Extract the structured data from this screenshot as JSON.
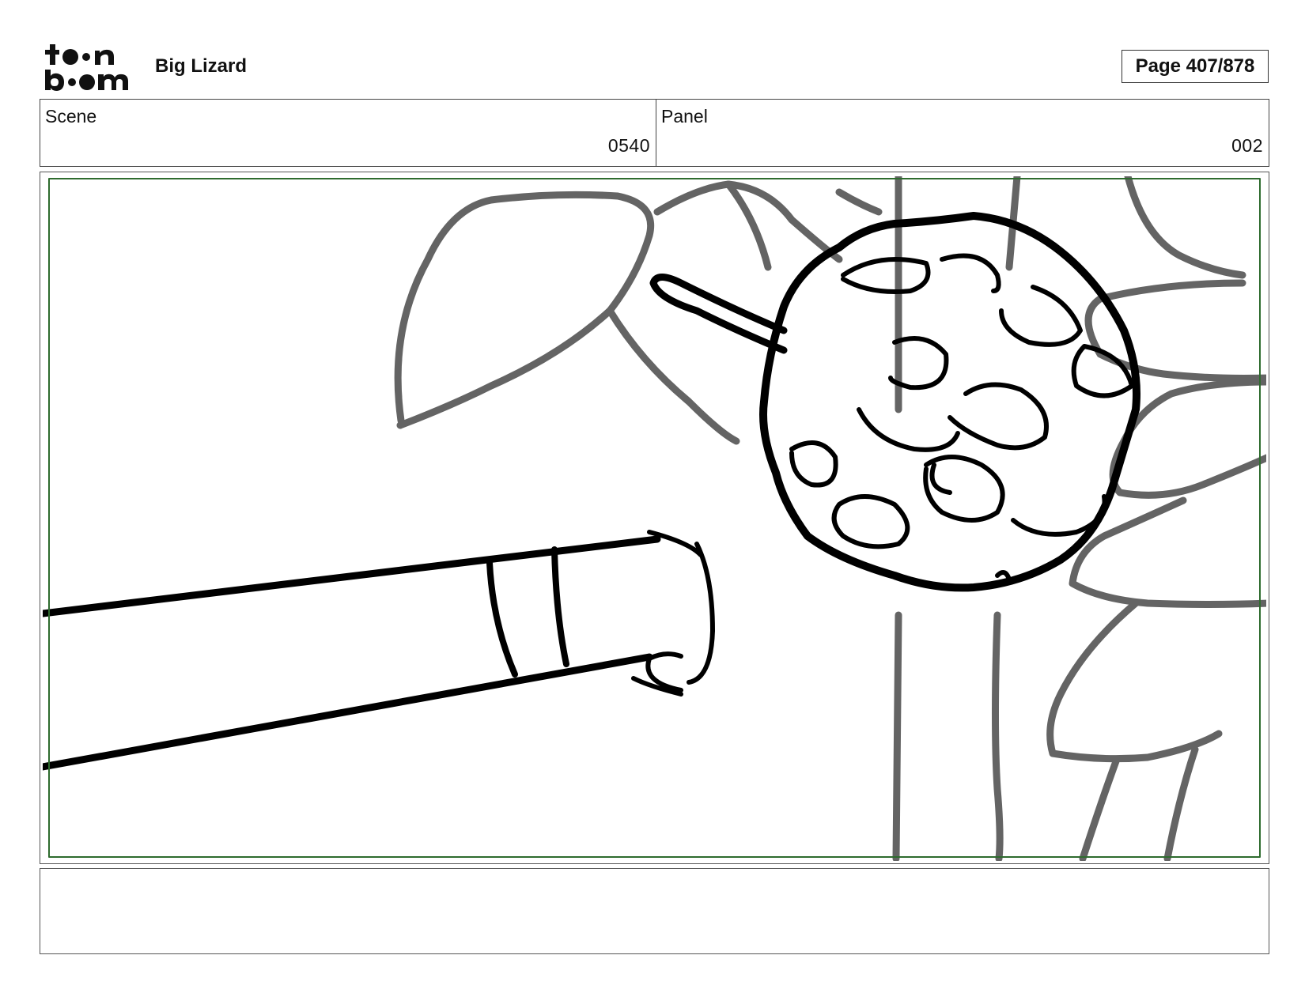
{
  "header": {
    "logo_text_top": "toon",
    "logo_text_bottom": "boom",
    "project_title": "Big Lizard",
    "page_indicator": "Page 407/878"
  },
  "info": {
    "scene_label": "Scene",
    "scene_value": "0540",
    "panel_label": "Panel",
    "panel_value": "002"
  },
  "colors": {
    "safe_frame": "#2e6b2e",
    "ink_dark": "#000000",
    "ink_gray": "#646464"
  },
  "notes": {
    "text": ""
  }
}
